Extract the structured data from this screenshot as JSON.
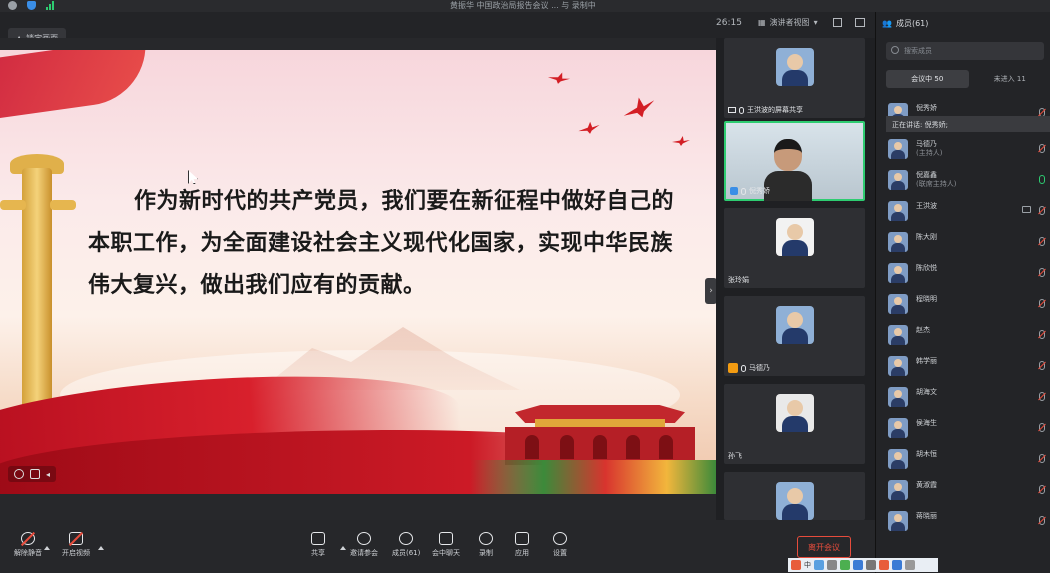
{
  "topbar": {
    "title": "黄振华  中国政治局报告会议 ... 与 录制中"
  },
  "subbar": {
    "lock_label": "锁定画面",
    "timer": "26:15",
    "view_label": "演讲者视图"
  },
  "slide": {
    "text": "作为新时代的共产党员，我们要在新征程中做好自己的本职工作，为全面建设社会主义现代化国家，实现中华民族伟大复兴，做出我们应有的贡献。"
  },
  "videos": [
    {
      "name": "王洪波的屏幕共享",
      "state": "avatar"
    },
    {
      "name": "倪秀娇",
      "state": "video"
    },
    {
      "name": "张玲娟",
      "state": "avatar"
    },
    {
      "name": "马德乃",
      "state": "avatar"
    },
    {
      "name": "孙飞",
      "state": "avatar"
    },
    {
      "name": "",
      "state": "avatar"
    }
  ],
  "panel": {
    "title": "成员(61)",
    "search_placeholder": "搜索成员",
    "tab_in_meeting": "会议中 50",
    "tab_not_joined": "未进入 11",
    "speaking": "正在讲话: 倪秀娇;",
    "members": [
      {
        "name": "倪秀娇",
        "role": "",
        "mic": "muted"
      },
      {
        "name": "马德乃",
        "role": "(主持人)",
        "mic": "muted"
      },
      {
        "name": "倪嘉鑫",
        "role": "(联席主持人)",
        "mic": "on"
      },
      {
        "name": "王洪波",
        "role": "",
        "mic": "muted",
        "cam": true
      },
      {
        "name": "陈大刚",
        "role": "",
        "mic": "muted"
      },
      {
        "name": "陈欣悦",
        "role": "",
        "mic": "muted"
      },
      {
        "name": "程晓明",
        "role": "",
        "mic": "muted"
      },
      {
        "name": "赵杰",
        "role": "",
        "mic": "muted"
      },
      {
        "name": "韩学丽",
        "role": "",
        "mic": "muted"
      },
      {
        "name": "胡海文",
        "role": "",
        "mic": "muted"
      },
      {
        "name": "侯海生",
        "role": "",
        "mic": "muted"
      },
      {
        "name": "胡木恒",
        "role": "",
        "mic": "muted"
      },
      {
        "name": "黄淑霞",
        "role": "",
        "mic": "muted"
      },
      {
        "name": "蒋晓丽",
        "role": "",
        "mic": "muted"
      }
    ]
  },
  "toolbar": {
    "mute": "解除静音",
    "video": "开启视频",
    "share": "共享",
    "invite": "邀请参会",
    "members": "成员(61)",
    "chat": "会中聊天",
    "record": "录制",
    "apps": "应用",
    "settings": "设置",
    "leave": "离开会议"
  },
  "tray": {
    "ime": "中"
  },
  "colors": {
    "accent_green": "#2ecc71",
    "danger_red": "#e74c3c"
  }
}
